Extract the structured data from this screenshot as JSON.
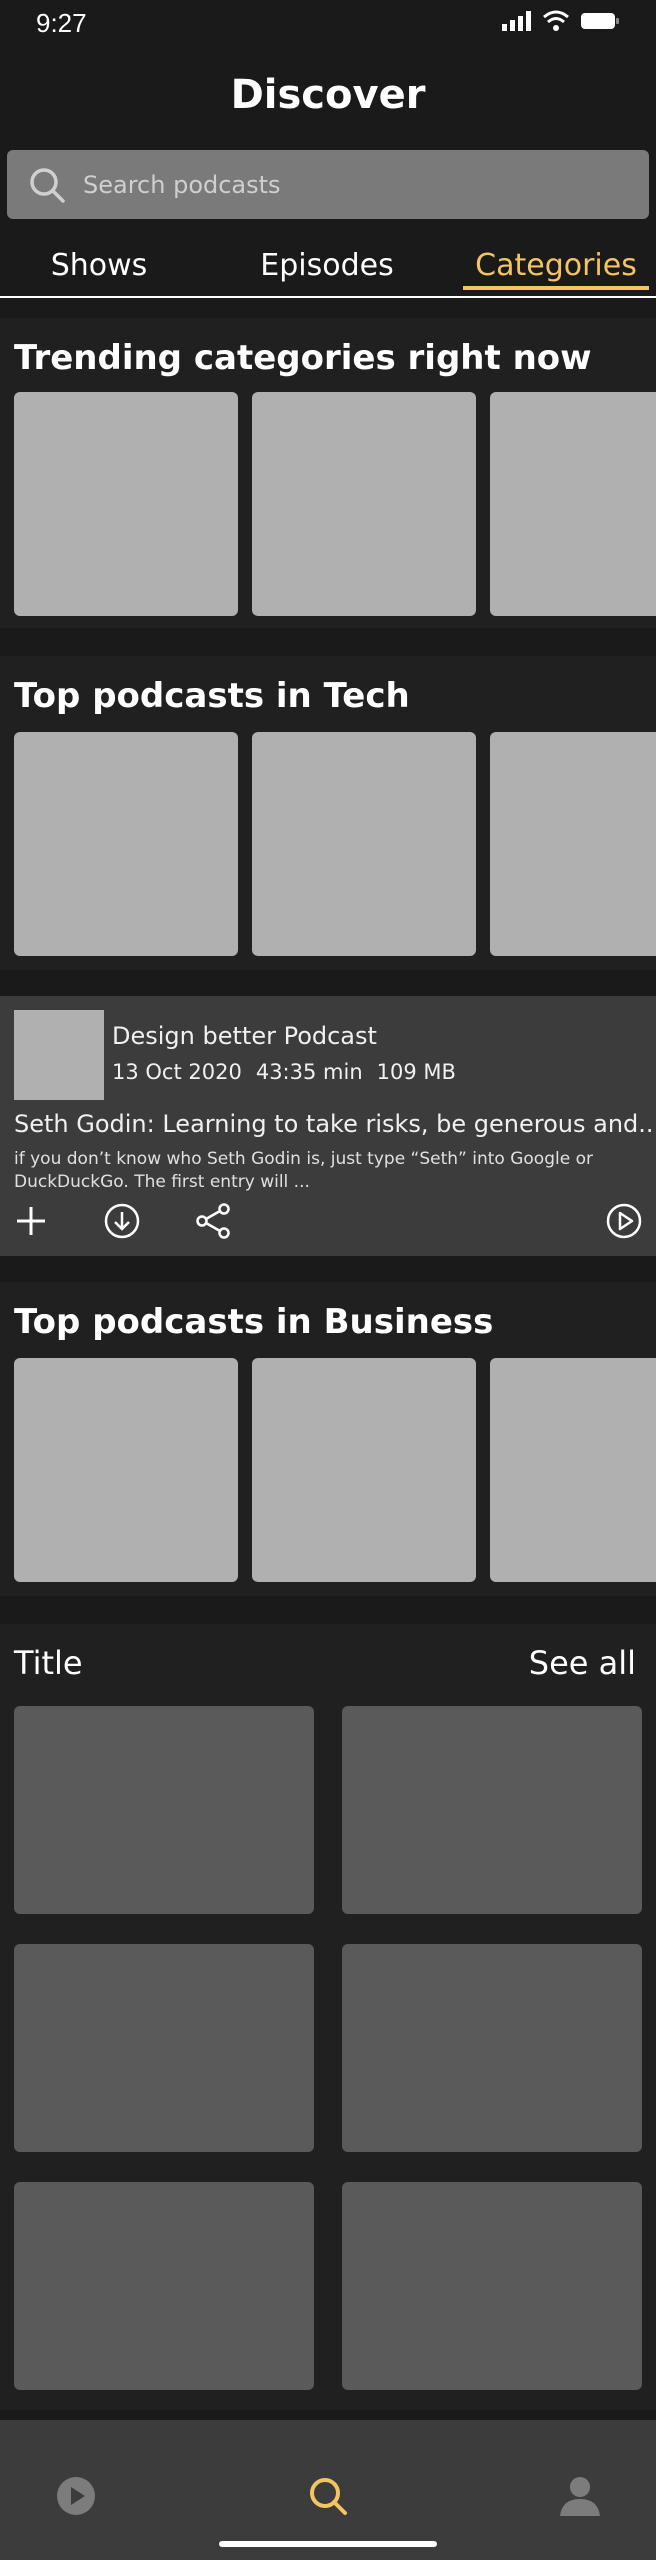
{
  "status_bar": {
    "time": "9:27"
  },
  "header": {
    "title": "Discover"
  },
  "search": {
    "placeholder": "Search podcasts"
  },
  "tabs": [
    {
      "label": "Shows",
      "active": false
    },
    {
      "label": "Episodes",
      "active": false
    },
    {
      "label": "Categories",
      "active": true
    }
  ],
  "sections": {
    "trending": {
      "title": "Trending categories right now"
    },
    "tech": {
      "title": "Top podcasts in Tech"
    },
    "business": {
      "title": "Top podcasts in Business"
    }
  },
  "episode": {
    "podcast": "Design better Podcast",
    "date": "13 Oct 2020",
    "duration": "43:35 min",
    "size": "109 MB",
    "title": "Seth Godin: Learning to take risks, be generous and...",
    "description": "if you don’t know who Seth Godin is, just type “Seth” into Google or DuckDuckGo.  The first entry will ..."
  },
  "grid": {
    "title": "Title",
    "see_all": "See all"
  },
  "colors": {
    "accent": "#f2c462",
    "background": "#1a1a1a",
    "section": "#202020",
    "card": "#3c3c3c"
  }
}
